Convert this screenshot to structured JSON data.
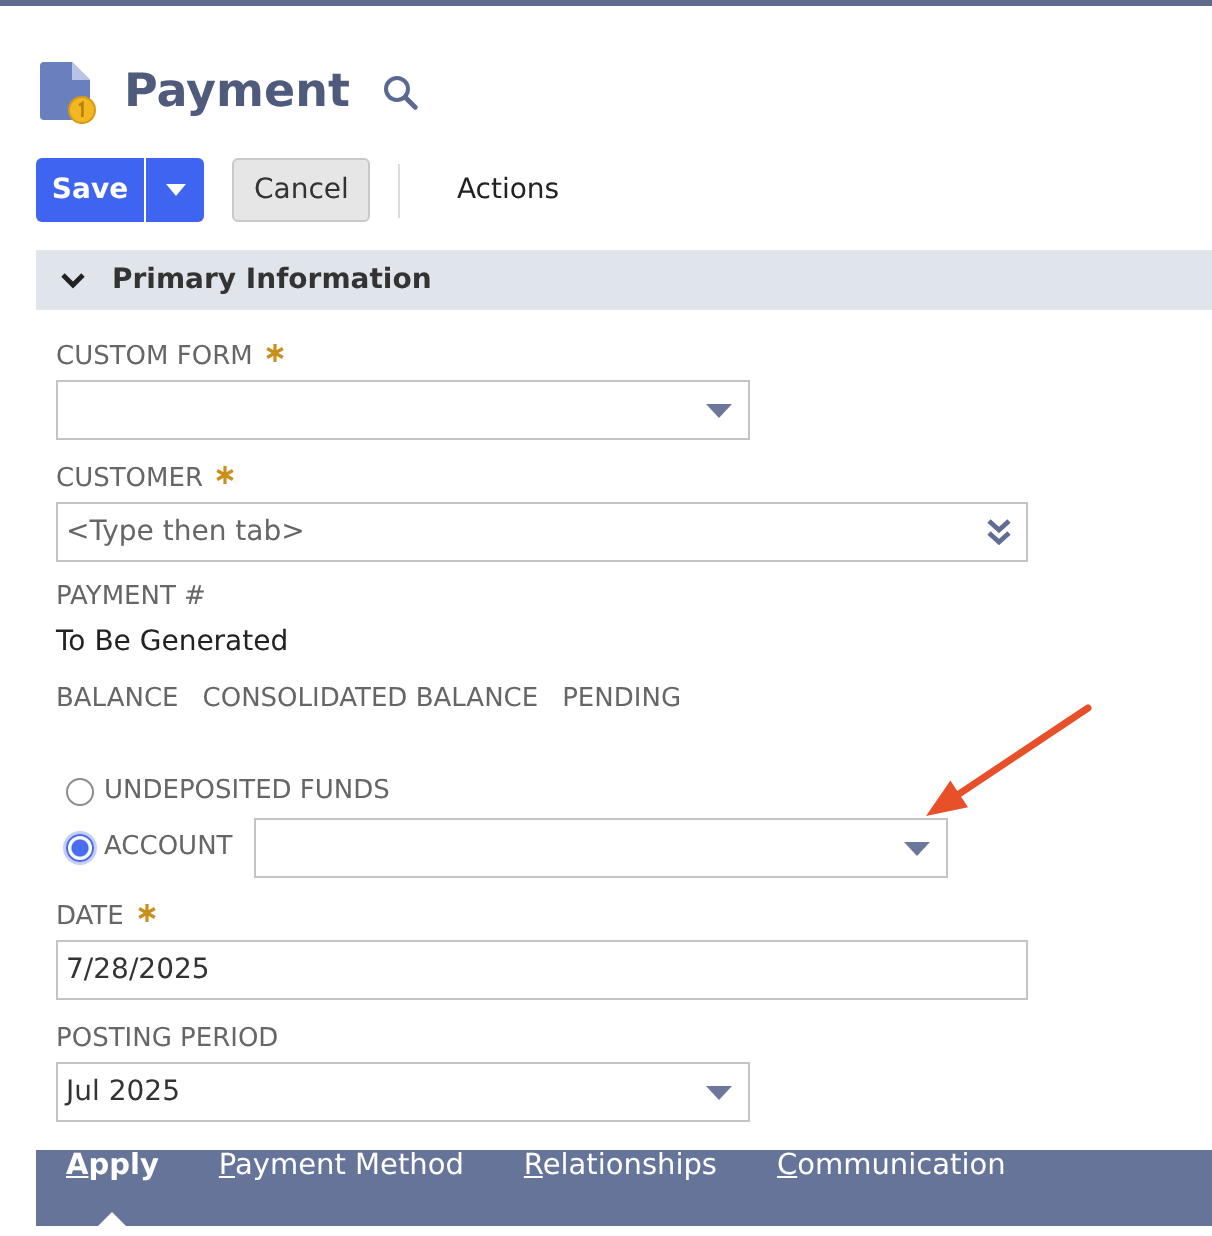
{
  "page_header": {
    "title": "Payment"
  },
  "toolbar": {
    "buttons": [
      {
        "kind": "primary",
        "label": "Save"
      },
      {
        "kind": "secondary",
        "label": "Cancel"
      }
    ],
    "menu": "Actions"
  },
  "section": {
    "title": "Primary Information",
    "expanded": true
  },
  "fields": [
    {
      "kind": "select",
      "label": "CUSTOM FORM",
      "required": true
    },
    {
      "kind": "autocomplete",
      "label": "CUSTOMER",
      "required": true,
      "placeholder": "<Type then tab>"
    },
    {
      "kind": "readonly",
      "label": "PAYMENT #",
      "required": false,
      "value": "To Be Generated"
    },
    {
      "kind": "captions",
      "labels": [
        "BALANCE",
        "CONSOLIDATED BALANCE",
        "PENDING"
      ]
    },
    {
      "kind": "radio_group",
      "options": [
        {
          "kind": "plain",
          "label": "UNDEPOSITED FUNDS",
          "selected": false
        },
        {
          "kind": "with_select",
          "label": "ACCOUNT",
          "selected": true
        }
      ]
    },
    {
      "kind": "text",
      "label": "DATE",
      "required": true,
      "value": "7/28/2025"
    },
    {
      "kind": "select",
      "label": "POSTING PERIOD",
      "required": false,
      "value": "Jul 2025"
    }
  ],
  "tabs": [
    {
      "label": "Apply",
      "selected": true
    },
    {
      "label": "Payment Method",
      "selected": false
    },
    {
      "label": "Relationships",
      "selected": false
    },
    {
      "label": "Communication",
      "selected": false
    }
  ],
  "annotations": [
    {
      "kind": "arrow"
    }
  ]
}
